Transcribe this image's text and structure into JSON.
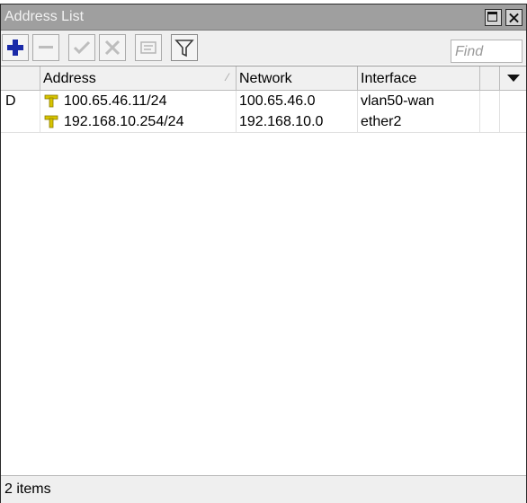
{
  "window": {
    "title": "Address List"
  },
  "toolbar": {
    "add_icon": "plus-icon",
    "remove_icon": "minus-icon",
    "enable_icon": "check-icon",
    "disable_icon": "x-icon",
    "comment_icon": "comment-icon",
    "filter_icon": "filter-icon",
    "find_placeholder": "Find"
  },
  "table": {
    "columns": [
      "",
      "Address",
      "Network",
      "Interface"
    ],
    "rows": [
      {
        "flag": "D",
        "address": "100.65.46.11/24",
        "network": "100.65.46.0",
        "interface": "vlan50-wan"
      },
      {
        "flag": "",
        "address": "192.168.10.254/24",
        "network": "192.168.10.0",
        "interface": "ether2"
      }
    ]
  },
  "status": {
    "count_text": "2 items"
  },
  "colors": {
    "titlebar": "#9f9f9f",
    "add_blue": "#1a2aa8",
    "address_icon": "#d8c400"
  }
}
